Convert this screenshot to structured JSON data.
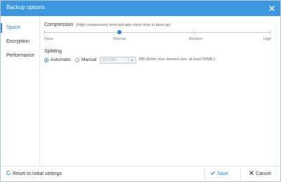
{
  "window": {
    "title": "Backup options"
  },
  "sidebar": {
    "items": [
      {
        "label": "Space",
        "active": true
      },
      {
        "label": "Encryption",
        "active": false
      },
      {
        "label": "Performance",
        "active": false
      }
    ]
  },
  "compression": {
    "title": "Compression",
    "note": "(High compression level will take more time to back up)",
    "levels": [
      "None",
      "Normal",
      "Medium",
      "High"
    ],
    "selected": "Normal"
  },
  "splitting": {
    "title": "Splitting",
    "options": [
      {
        "label": "Automatic",
        "selected": true
      },
      {
        "label": "Manual",
        "selected": false
      }
    ],
    "select_value": "CD-650",
    "hint": "MB (Enter your desired size, at least 50MB.)"
  },
  "footer": {
    "reset_label": "Reset to initial settings",
    "save_label": "Save",
    "cancel_label": "Cancel"
  },
  "colors": {
    "titlebar": "#3b97e0",
    "accent": "#2e86d8"
  },
  "icons": {
    "close": "close-icon",
    "reset": "reset-icon",
    "save": "check-icon",
    "cancel": "x-icon",
    "select": "chevron-down-icon"
  }
}
